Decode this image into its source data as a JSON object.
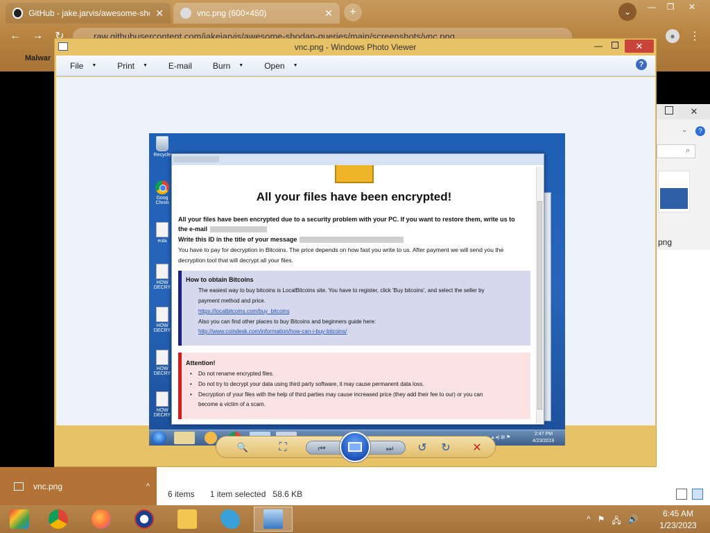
{
  "browser": {
    "tabs": [
      {
        "title": "GitHub - jake.jarvis/awesome-shod",
        "close": "✕"
      },
      {
        "title": "vnc.png (600×450)",
        "close": "✕"
      }
    ],
    "new_tab": "+",
    "url": "raw.githubusercontent.com/jakejarvis/awesome-shodan-queries/main/screenshots/vnc.png",
    "bookmark": "Malwar",
    "window_controls": {
      "minimize": "—",
      "restore": "❐",
      "close": "✕"
    }
  },
  "viewer": {
    "title": "vnc.png - Windows Photo Viewer",
    "menu": [
      "File",
      "Print",
      "E-mail",
      "Burn",
      "Open"
    ],
    "menu_has_caret": [
      true,
      true,
      false,
      true,
      true
    ],
    "help": "?",
    "controls": {
      "zoom": "🔍",
      "actual_size": "⛶",
      "prev": "⏮",
      "next": "⏭",
      "rotate_ccw": "↺",
      "rotate_cw": "↻",
      "delete": "✕"
    }
  },
  "image": {
    "desktop_icons": [
      "Recycle",
      "Goog Chron",
      "eula",
      "HOW DECRY",
      "HOW DECRY",
      "HOW DECRY",
      "HOW DECRY"
    ],
    "ransom": {
      "title": "All your files have been encrypted!",
      "line1": "All your files have been encrypted due to a security problem with your PC. If you want to restore them, write us to",
      "line2": "the e-mail",
      "line3": "Write this ID in the title of your message",
      "line4": "You have to pay for decryption in Bitcoins. The price depends on how fast you write to us. After payment we will send you the",
      "line5": "decryption tool that will decrypt all your files.",
      "bitcoin": {
        "heading": "How to obtain Bitcoins",
        "text1": "The easiest way to buy bitcoins is LocalBitcoins site. You have to register, click 'Buy bitcoins', and select the seller by",
        "text2": "payment method and price.",
        "link1": "https://localbitcoins.com/buy_bitcoins",
        "text3": "Also you can find other places to buy Bitcoins and beginners guide here:",
        "link2": "http://www.coindesk.com/information/how-can-i-buy-bitcoins/"
      },
      "attention": {
        "heading": "Attention!",
        "items": [
          "Do not rename encrypted files.",
          "Do not try to decrypt your data using third party software, it may cause permanent data loss.",
          "Decryption of your files with the help of third parties may cause increased price (they add their fee to our) or you can"
        ],
        "item3_cont": "become a victim of a scam."
      }
    },
    "vm_clock": {
      "time": "2:47 PM",
      "date": "4/23/2019"
    }
  },
  "explorer": {
    "file_label": "png",
    "status": {
      "items": "6 items",
      "selected": "1 item selected",
      "size": "58.6 KB"
    }
  },
  "download": {
    "filename": "vnc.png",
    "caret": "^"
  },
  "taskbar": {
    "clock_time": "6:45 AM",
    "clock_date": "1/23/2023",
    "tray": [
      "^",
      "⚑",
      "🖧",
      "🔊"
    ]
  }
}
